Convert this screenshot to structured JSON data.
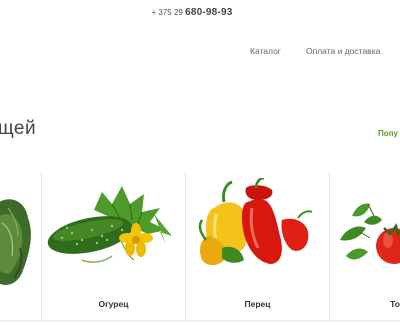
{
  "header": {
    "phone_prefix": "+ 375 29",
    "phone_number": "680-98-93"
  },
  "nav": {
    "items": [
      {
        "label": "Каталог"
      },
      {
        "label": "Оплата и доставка"
      }
    ]
  },
  "section": {
    "title_fragment": "щей",
    "popular_fragment": "Попу"
  },
  "products": [
    {
      "label": ""
    },
    {
      "label": "Огурец"
    },
    {
      "label": "Перец"
    },
    {
      "label": "То"
    }
  ]
}
